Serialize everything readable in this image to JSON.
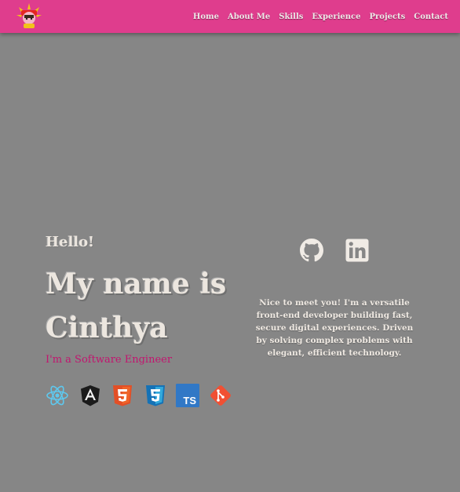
{
  "nav": {
    "logo_icon": "character-logo-icon",
    "links": [
      "Home",
      "About Me",
      "Skills",
      "Experience",
      "Projects",
      "Contact"
    ]
  },
  "hero": {
    "greeting": "Hello!",
    "name": "My name is Cinthya",
    "role": "I'm a Software Engineer",
    "tech_icons": [
      "react-icon",
      "angular-icon",
      "html5-icon",
      "css3-icon",
      "typescript-icon",
      "git-icon"
    ]
  },
  "social": {
    "icons": [
      "github-icon",
      "linkedin-icon"
    ]
  },
  "about": {
    "text": "Nice to meet you! I'm a versatile front-end developer building fast, secure digital experiences. Driven by solving complex problems with elegant, efficient technology."
  },
  "colors": {
    "navbar": "#df3d8d",
    "background": "#868686",
    "accent": "#c2156f",
    "light_text": "#ece6df"
  }
}
